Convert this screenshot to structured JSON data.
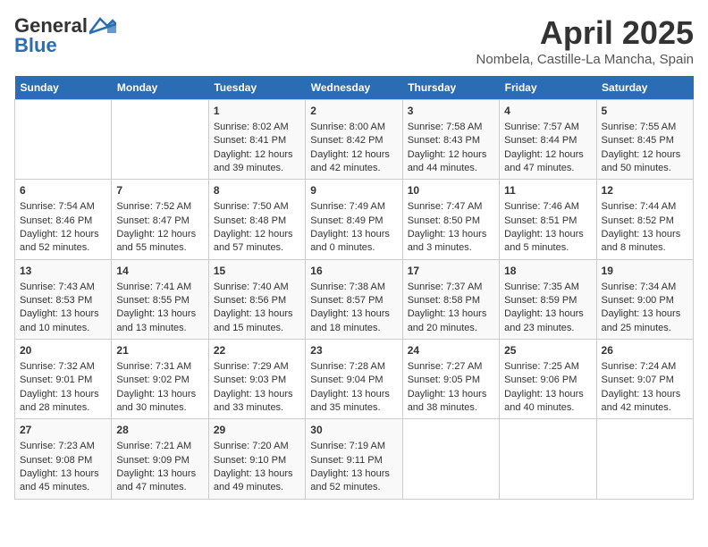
{
  "header": {
    "logo_line1": "General",
    "logo_line2": "Blue",
    "title": "April 2025",
    "subtitle": "Nombela, Castille-La Mancha, Spain"
  },
  "days_of_week": [
    "Sunday",
    "Monday",
    "Tuesday",
    "Wednesday",
    "Thursday",
    "Friday",
    "Saturday"
  ],
  "weeks": [
    [
      {
        "day": "",
        "sunrise": "",
        "sunset": "",
        "daylight": ""
      },
      {
        "day": "",
        "sunrise": "",
        "sunset": "",
        "daylight": ""
      },
      {
        "day": "1",
        "sunrise": "Sunrise: 8:02 AM",
        "sunset": "Sunset: 8:41 PM",
        "daylight": "Daylight: 12 hours and 39 minutes."
      },
      {
        "day": "2",
        "sunrise": "Sunrise: 8:00 AM",
        "sunset": "Sunset: 8:42 PM",
        "daylight": "Daylight: 12 hours and 42 minutes."
      },
      {
        "day": "3",
        "sunrise": "Sunrise: 7:58 AM",
        "sunset": "Sunset: 8:43 PM",
        "daylight": "Daylight: 12 hours and 44 minutes."
      },
      {
        "day": "4",
        "sunrise": "Sunrise: 7:57 AM",
        "sunset": "Sunset: 8:44 PM",
        "daylight": "Daylight: 12 hours and 47 minutes."
      },
      {
        "day": "5",
        "sunrise": "Sunrise: 7:55 AM",
        "sunset": "Sunset: 8:45 PM",
        "daylight": "Daylight: 12 hours and 50 minutes."
      }
    ],
    [
      {
        "day": "6",
        "sunrise": "Sunrise: 7:54 AM",
        "sunset": "Sunset: 8:46 PM",
        "daylight": "Daylight: 12 hours and 52 minutes."
      },
      {
        "day": "7",
        "sunrise": "Sunrise: 7:52 AM",
        "sunset": "Sunset: 8:47 PM",
        "daylight": "Daylight: 12 hours and 55 minutes."
      },
      {
        "day": "8",
        "sunrise": "Sunrise: 7:50 AM",
        "sunset": "Sunset: 8:48 PM",
        "daylight": "Daylight: 12 hours and 57 minutes."
      },
      {
        "day": "9",
        "sunrise": "Sunrise: 7:49 AM",
        "sunset": "Sunset: 8:49 PM",
        "daylight": "Daylight: 13 hours and 0 minutes."
      },
      {
        "day": "10",
        "sunrise": "Sunrise: 7:47 AM",
        "sunset": "Sunset: 8:50 PM",
        "daylight": "Daylight: 13 hours and 3 minutes."
      },
      {
        "day": "11",
        "sunrise": "Sunrise: 7:46 AM",
        "sunset": "Sunset: 8:51 PM",
        "daylight": "Daylight: 13 hours and 5 minutes."
      },
      {
        "day": "12",
        "sunrise": "Sunrise: 7:44 AM",
        "sunset": "Sunset: 8:52 PM",
        "daylight": "Daylight: 13 hours and 8 minutes."
      }
    ],
    [
      {
        "day": "13",
        "sunrise": "Sunrise: 7:43 AM",
        "sunset": "Sunset: 8:53 PM",
        "daylight": "Daylight: 13 hours and 10 minutes."
      },
      {
        "day": "14",
        "sunrise": "Sunrise: 7:41 AM",
        "sunset": "Sunset: 8:55 PM",
        "daylight": "Daylight: 13 hours and 13 minutes."
      },
      {
        "day": "15",
        "sunrise": "Sunrise: 7:40 AM",
        "sunset": "Sunset: 8:56 PM",
        "daylight": "Daylight: 13 hours and 15 minutes."
      },
      {
        "day": "16",
        "sunrise": "Sunrise: 7:38 AM",
        "sunset": "Sunset: 8:57 PM",
        "daylight": "Daylight: 13 hours and 18 minutes."
      },
      {
        "day": "17",
        "sunrise": "Sunrise: 7:37 AM",
        "sunset": "Sunset: 8:58 PM",
        "daylight": "Daylight: 13 hours and 20 minutes."
      },
      {
        "day": "18",
        "sunrise": "Sunrise: 7:35 AM",
        "sunset": "Sunset: 8:59 PM",
        "daylight": "Daylight: 13 hours and 23 minutes."
      },
      {
        "day": "19",
        "sunrise": "Sunrise: 7:34 AM",
        "sunset": "Sunset: 9:00 PM",
        "daylight": "Daylight: 13 hours and 25 minutes."
      }
    ],
    [
      {
        "day": "20",
        "sunrise": "Sunrise: 7:32 AM",
        "sunset": "Sunset: 9:01 PM",
        "daylight": "Daylight: 13 hours and 28 minutes."
      },
      {
        "day": "21",
        "sunrise": "Sunrise: 7:31 AM",
        "sunset": "Sunset: 9:02 PM",
        "daylight": "Daylight: 13 hours and 30 minutes."
      },
      {
        "day": "22",
        "sunrise": "Sunrise: 7:29 AM",
        "sunset": "Sunset: 9:03 PM",
        "daylight": "Daylight: 13 hours and 33 minutes."
      },
      {
        "day": "23",
        "sunrise": "Sunrise: 7:28 AM",
        "sunset": "Sunset: 9:04 PM",
        "daylight": "Daylight: 13 hours and 35 minutes."
      },
      {
        "day": "24",
        "sunrise": "Sunrise: 7:27 AM",
        "sunset": "Sunset: 9:05 PM",
        "daylight": "Daylight: 13 hours and 38 minutes."
      },
      {
        "day": "25",
        "sunrise": "Sunrise: 7:25 AM",
        "sunset": "Sunset: 9:06 PM",
        "daylight": "Daylight: 13 hours and 40 minutes."
      },
      {
        "day": "26",
        "sunrise": "Sunrise: 7:24 AM",
        "sunset": "Sunset: 9:07 PM",
        "daylight": "Daylight: 13 hours and 42 minutes."
      }
    ],
    [
      {
        "day": "27",
        "sunrise": "Sunrise: 7:23 AM",
        "sunset": "Sunset: 9:08 PM",
        "daylight": "Daylight: 13 hours and 45 minutes."
      },
      {
        "day": "28",
        "sunrise": "Sunrise: 7:21 AM",
        "sunset": "Sunset: 9:09 PM",
        "daylight": "Daylight: 13 hours and 47 minutes."
      },
      {
        "day": "29",
        "sunrise": "Sunrise: 7:20 AM",
        "sunset": "Sunset: 9:10 PM",
        "daylight": "Daylight: 13 hours and 49 minutes."
      },
      {
        "day": "30",
        "sunrise": "Sunrise: 7:19 AM",
        "sunset": "Sunset: 9:11 PM",
        "daylight": "Daylight: 13 hours and 52 minutes."
      },
      {
        "day": "",
        "sunrise": "",
        "sunset": "",
        "daylight": ""
      },
      {
        "day": "",
        "sunrise": "",
        "sunset": "",
        "daylight": ""
      },
      {
        "day": "",
        "sunrise": "",
        "sunset": "",
        "daylight": ""
      }
    ]
  ]
}
